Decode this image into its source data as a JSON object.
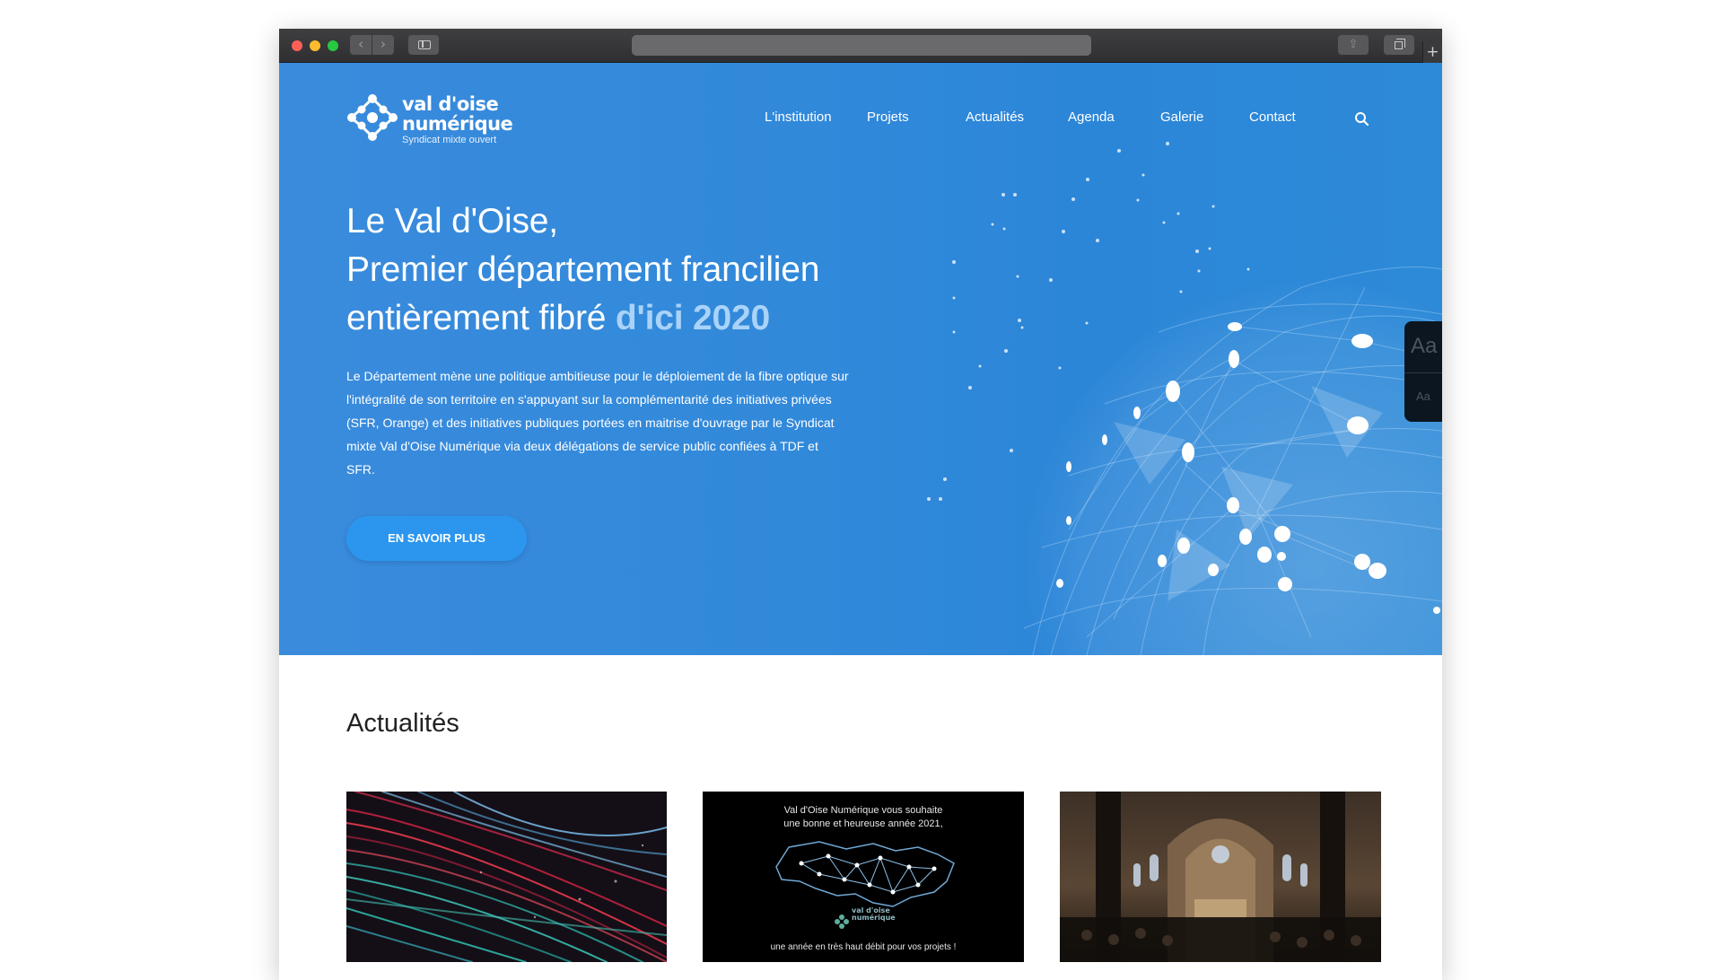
{
  "browser": {
    "back_glyph": "‹",
    "forward_glyph": "›",
    "share_glyph": "⇪",
    "newtab_glyph": "+"
  },
  "site": {
    "logo": {
      "line1": "val d'oise",
      "line2": "numérique",
      "tagline": "Syndicat mixte ouvert"
    },
    "nav": [
      "L'institution",
      "Projets",
      "Actualités",
      "Agenda",
      "Galerie",
      "Contact"
    ],
    "search_icon": "search-icon"
  },
  "hero": {
    "title_line1": "Le Val d'Oise,",
    "title_line2": "Premier département francilien",
    "title_line3_prefix": "entièrement fibré ",
    "title_line3_accent": "d'ici 2020",
    "body": "Le Département mène une politique ambitieuse pour le déploiement de la fibre optique sur l'intégralité de son territoire en s'appuyant sur la complémentarité des initiatives privées (SFR, Orange) et des initiatives publiques portées en maitrise d'ouvrage par le Syndicat  mixte Val d'Oise Numérique via deux délégations de service public confiées à TDF et SFR.",
    "cta": "EN SAVOIR PLUS"
  },
  "font_widget": {
    "large": "Aa",
    "small": "Aa"
  },
  "news": {
    "heading": "Actualités",
    "cards": [
      {
        "image": "fibre-optique-lumieres"
      },
      {
        "image": "voeux-2021",
        "line1": "Val d'Oise Numérique vous souhaite",
        "line2": "une bonne et heureuse année 2021,",
        "logo_line1": "val d'oise",
        "logo_line2": "numérique",
        "footer": "une année en très haut débit pour vos projets !"
      },
      {
        "image": "concert-abbaye"
      }
    ]
  },
  "colors": {
    "hero_blue": "#3189da",
    "accent_light_blue": "#a9d3f8",
    "cta_blue": "#2c96ee"
  }
}
